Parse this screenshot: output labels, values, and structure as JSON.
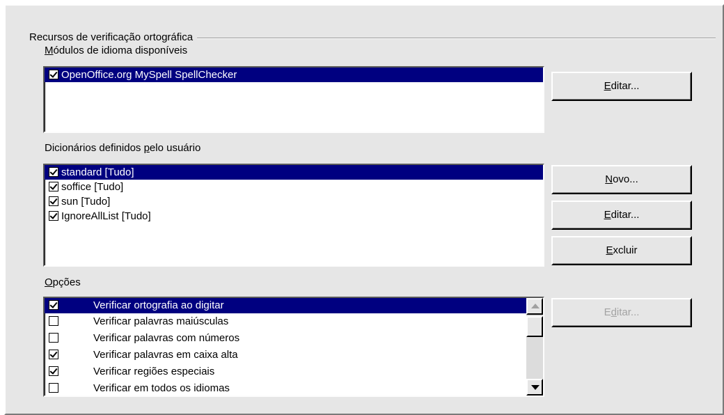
{
  "group": {
    "title": "Recursos de verificação ortográfica"
  },
  "modules": {
    "label_prefix": "M",
    "label_rest": "ódulos de idioma disponíveis",
    "items": [
      {
        "label": "OpenOffice.org MySpell SpellChecker",
        "checked": true,
        "selected": true
      }
    ],
    "edit_button": {
      "mnemonic": "E",
      "rest": "ditar..."
    }
  },
  "dictionaries": {
    "label_before": "Dicionários definidos ",
    "label_mnemonic": "p",
    "label_after": "elo usuário",
    "items": [
      {
        "label": "standard [Tudo]",
        "checked": true,
        "selected": true
      },
      {
        "label": "soffice [Tudo]",
        "checked": true,
        "selected": false
      },
      {
        "label": "sun [Tudo]",
        "checked": true,
        "selected": false
      },
      {
        "label": "IgnoreAllList [Tudo]",
        "checked": true,
        "selected": false
      }
    ],
    "new_button": {
      "mnemonic": "N",
      "rest": "ovo..."
    },
    "edit_button": {
      "mnemonic": "E",
      "rest": "ditar..."
    },
    "delete_button": {
      "mnemonic": "E",
      "rest": "xcluir"
    }
  },
  "options": {
    "label_mnemonic": "O",
    "label_rest": "pções",
    "items": [
      {
        "label": "Verificar ortografia ao digitar",
        "checked": true,
        "selected": true
      },
      {
        "label": "Verificar palavras maiúsculas",
        "checked": false,
        "selected": false
      },
      {
        "label": "Verificar palavras com números",
        "checked": false,
        "selected": false
      },
      {
        "label": "Verificar palavras em caixa alta",
        "checked": true,
        "selected": false
      },
      {
        "label": "Verificar regiões especiais",
        "checked": true,
        "selected": false
      },
      {
        "label": "Verificar em todos os idiomas",
        "checked": false,
        "selected": false
      }
    ],
    "edit_button": {
      "before": "E",
      "mnemonic": "d",
      "rest": "itar..."
    }
  },
  "colors": {
    "selection": "#000080",
    "face": "#e6e6e6",
    "disabled_text": "#a3a3a3"
  }
}
